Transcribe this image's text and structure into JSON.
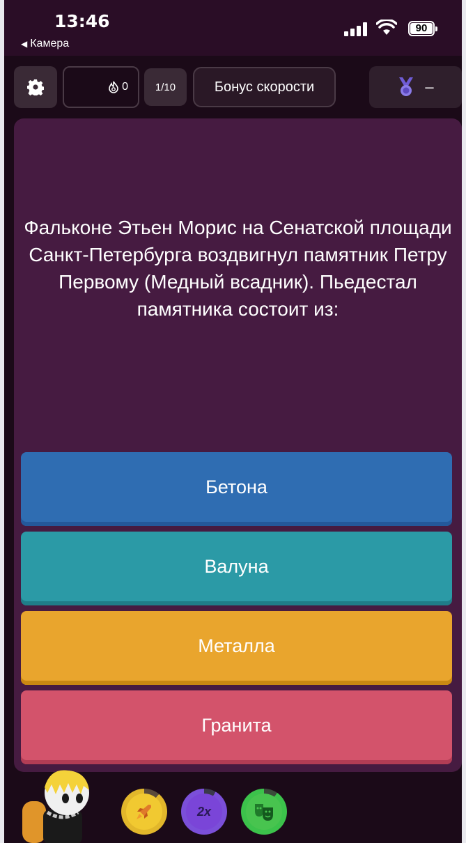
{
  "status_bar": {
    "time": "13:46",
    "back_label": "Камера",
    "battery": "90"
  },
  "top_bar": {
    "streak_count": "0",
    "question_counter": "1/10",
    "bonus_label": "Бонус скорости",
    "medal_value": "–"
  },
  "question": {
    "text": "Фальконе Этьен Морис на Сенатской площади Санкт-Петербурга воздвигнул памятник Петру Первому (Медный всадник). Пьедестал памятника состоит из:"
  },
  "answers": [
    {
      "label": "Бетона",
      "color": "#2f6db2"
    },
    {
      "label": "Валуна",
      "color": "#2b9aa6"
    },
    {
      "label": "Металла",
      "color": "#e9a52d"
    },
    {
      "label": "Гранита",
      "color": "#d3536b"
    }
  ],
  "powerups": [
    {
      "icon": "rocket-icon"
    },
    {
      "label": "2x"
    },
    {
      "icon": "theater-masks-icon"
    }
  ]
}
